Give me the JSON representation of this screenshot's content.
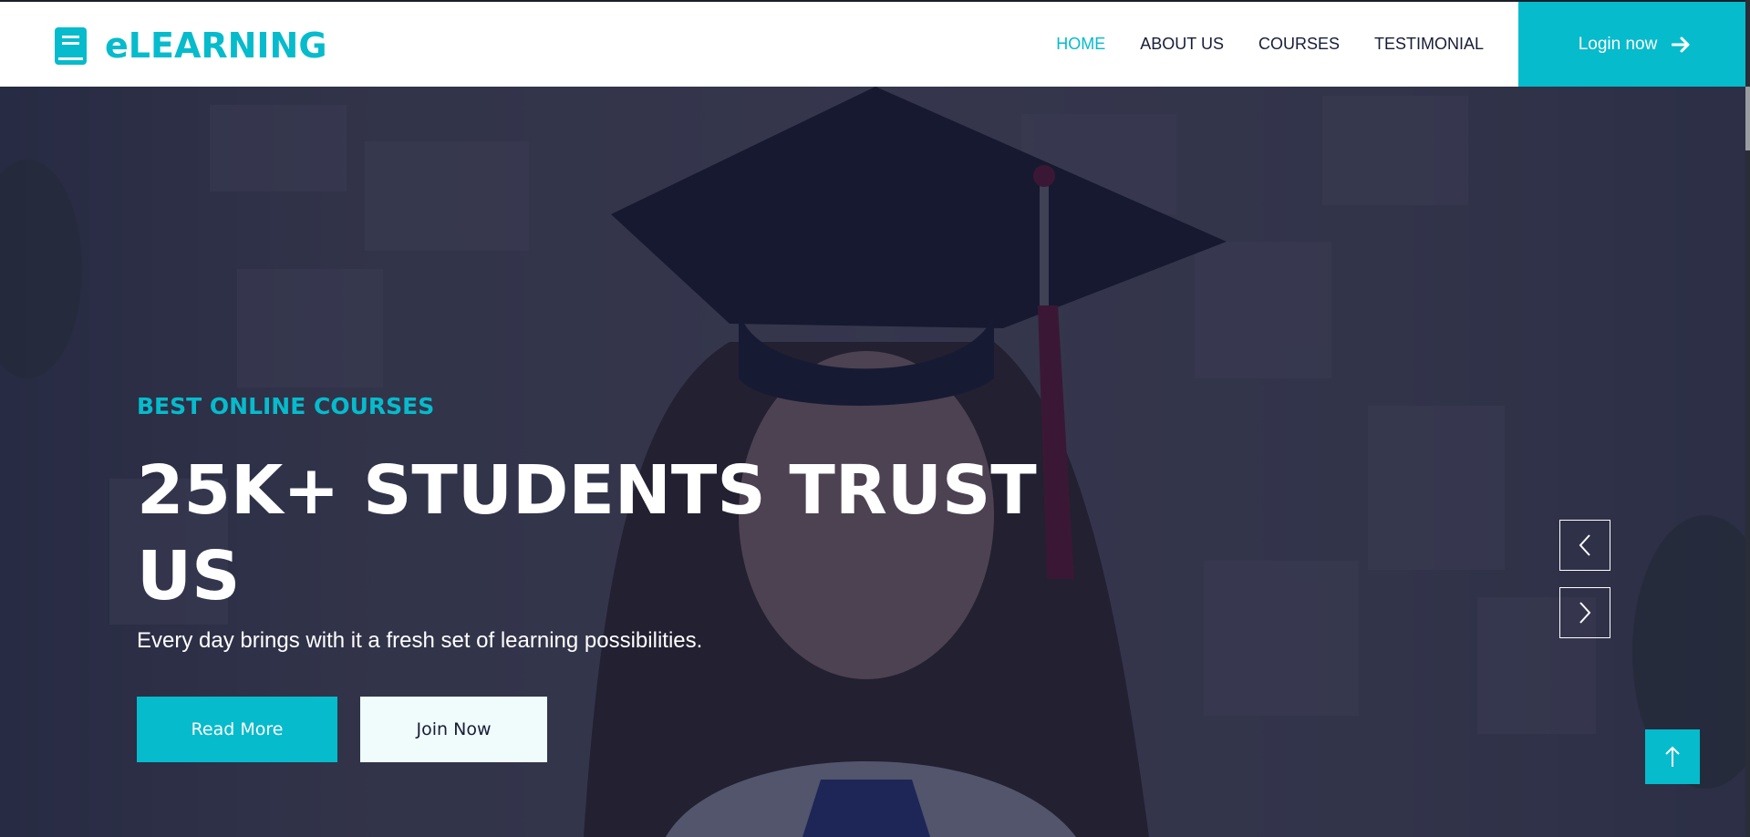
{
  "brand": {
    "name": "eLEARNING",
    "icon": "book-icon",
    "color": "#06bbcc"
  },
  "nav": {
    "items": [
      {
        "label": "HOME",
        "active": true
      },
      {
        "label": "ABOUT US",
        "active": false
      },
      {
        "label": "COURSES",
        "active": false
      },
      {
        "label": "TESTIMONIAL",
        "active": false
      }
    ],
    "login_label": "Login now",
    "login_icon": "arrow-right-icon"
  },
  "hero": {
    "eyebrow": "BEST ONLINE COURSES",
    "title": "25K+ STUDENTS TRUST US",
    "subtitle": "Every day brings with it a fresh set of learning possibilities.",
    "primary_button": "Read More",
    "secondary_button": "Join Now",
    "prev_icon": "chevron-left-icon",
    "next_icon": "chevron-right-icon"
  },
  "back_to_top_icon": "arrow-up-icon",
  "colors": {
    "accent": "#06bbcc",
    "dark": "#181d38",
    "light": "#f0fbfc"
  }
}
